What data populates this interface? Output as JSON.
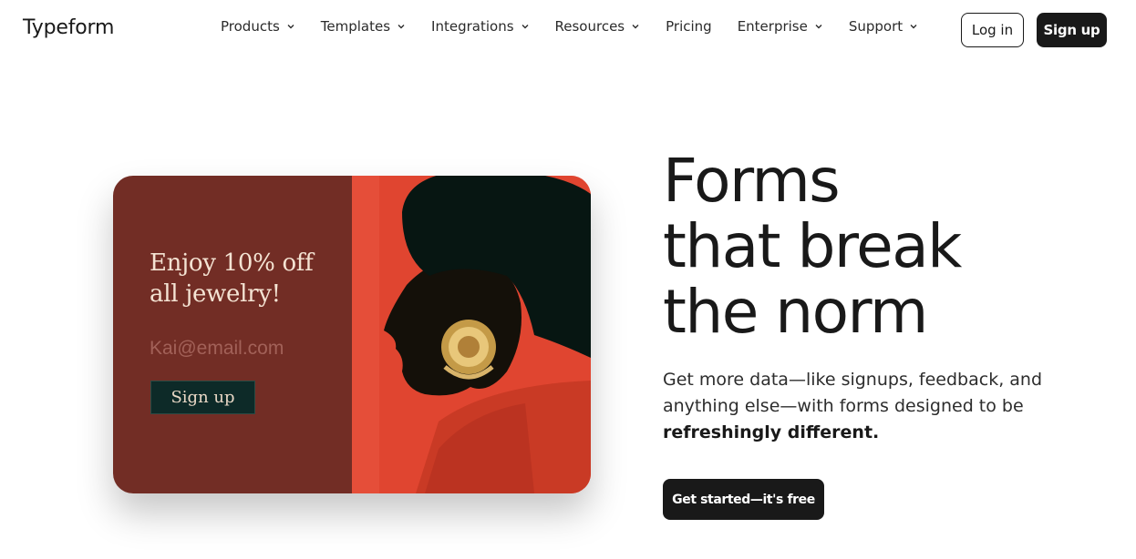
{
  "header": {
    "logo": "Typeform",
    "nav": [
      {
        "label": "Products",
        "has_dropdown": true
      },
      {
        "label": "Templates",
        "has_dropdown": true
      },
      {
        "label": "Integrations",
        "has_dropdown": true
      },
      {
        "label": "Resources",
        "has_dropdown": true
      },
      {
        "label": "Pricing",
        "has_dropdown": false
      },
      {
        "label": "Enterprise",
        "has_dropdown": true
      },
      {
        "label": "Support",
        "has_dropdown": true
      }
    ],
    "login_label": "Log in",
    "signup_label": "Sign up"
  },
  "card": {
    "headline_line1": "Enjoy 10% off",
    "headline_line2": "all jewelry!",
    "email_placeholder": "Kai@email.com",
    "button_label": "Sign up",
    "colors": {
      "left_panel": "#722d25",
      "right_panel": "#e04530",
      "button": "#0d2a28"
    }
  },
  "hero": {
    "title_line1": "Forms",
    "title_line2": "that break",
    "title_line3": "the norm",
    "subtitle_part1": "Get more data—like signups, feedback, and anything else—with forms designed to be ",
    "subtitle_bold": "refreshingly different.",
    "cta_label": "Get started—it's free"
  },
  "colors": {
    "primary": "#191919",
    "background": "#ffffff"
  }
}
